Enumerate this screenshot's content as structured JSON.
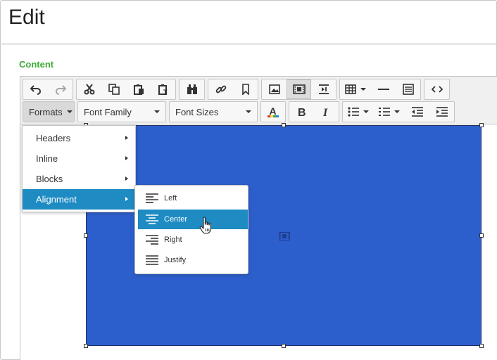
{
  "page": {
    "title": "Edit"
  },
  "form": {
    "content_label": "Content"
  },
  "toolbar": {
    "formats_label": "Formats",
    "font_family_label": "Font Family",
    "font_sizes_label": "Font Sizes"
  },
  "formats_menu": {
    "items": [
      {
        "label": "Headers"
      },
      {
        "label": "Inline"
      },
      {
        "label": "Blocks"
      },
      {
        "label": "Alignment"
      }
    ]
  },
  "alignment_menu": {
    "items": [
      {
        "label": "Left"
      },
      {
        "label": "Center"
      },
      {
        "label": "Right"
      },
      {
        "label": "Justify"
      }
    ]
  },
  "colors": {
    "content_label": "#3aaa35",
    "media_fill": "#2d5fcc",
    "menu_highlight": "#1e8bc3"
  }
}
